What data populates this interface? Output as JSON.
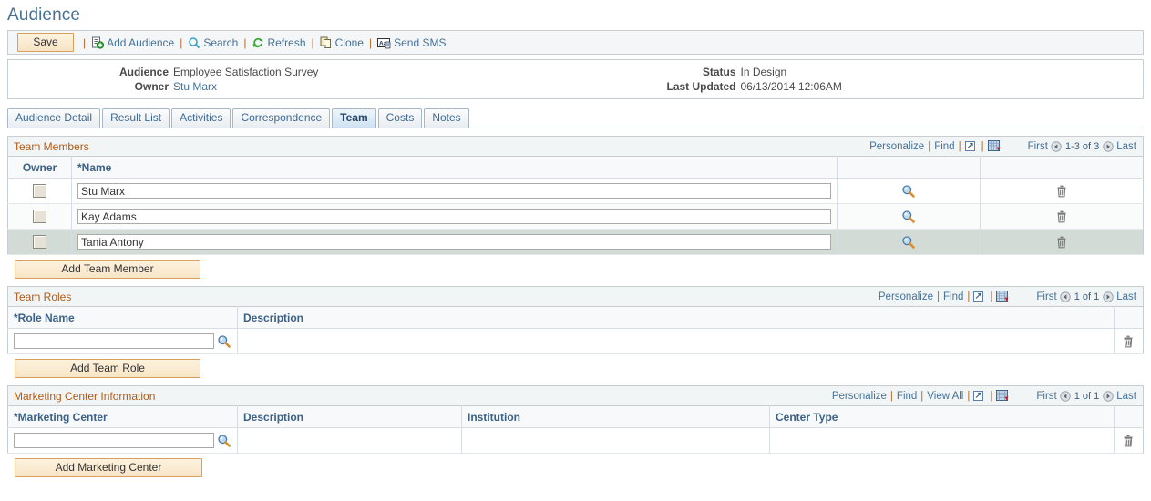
{
  "page": {
    "title": "Audience"
  },
  "toolbar": {
    "save_label": "Save",
    "items": [
      {
        "label": "Add Audience",
        "icon": "add-audience-icon"
      },
      {
        "label": "Search",
        "icon": "search-icon"
      },
      {
        "label": "Refresh",
        "icon": "refresh-icon"
      },
      {
        "label": "Clone",
        "icon": "clone-icon"
      },
      {
        "label": "Send SMS",
        "icon": "send-sms-icon"
      }
    ],
    "separator": "|"
  },
  "summary": {
    "audience_label": "Audience",
    "audience_value": "Employee Satisfaction Survey",
    "owner_label": "Owner",
    "owner_value": "Stu Marx",
    "status_label": "Status",
    "status_value": "In Design",
    "last_updated_label": "Last Updated",
    "last_updated_value": "06/13/2014 12:06AM"
  },
  "tabs": [
    {
      "label": "Audience Detail",
      "accesskey": "D",
      "active": false
    },
    {
      "label": "Result List",
      "accesskey": "R",
      "active": false
    },
    {
      "label": "Activities",
      "accesskey": "A",
      "active": false
    },
    {
      "label": "Correspondence",
      "accesskey": "p",
      "active": false
    },
    {
      "label": "Team",
      "accesskey": "",
      "active": true
    },
    {
      "label": "Costs",
      "accesskey": "C",
      "active": false
    },
    {
      "label": "Notes",
      "accesskey": "N",
      "active": false
    }
  ],
  "team_members": {
    "title": "Team Members",
    "tools": {
      "personalize": "Personalize",
      "find": "Find",
      "sep": "|",
      "expand_icon": "expand-grid-icon",
      "download_icon": "download-spreadsheet-icon"
    },
    "nav": {
      "first": "First",
      "prev_icon": "previous-page-icon",
      "range": "1-3 of 3",
      "next_icon": "next-page-icon",
      "last": "Last"
    },
    "columns": [
      "Owner",
      "*Name",
      "",
      ""
    ],
    "rows": [
      {
        "owner_checked": false,
        "name": "Stu Marx"
      },
      {
        "owner_checked": false,
        "name": "Kay Adams"
      },
      {
        "owner_checked": false,
        "name": "Tania Antony"
      }
    ],
    "add_button": "Add Team Member"
  },
  "team_roles": {
    "title": "Team Roles",
    "tools": {
      "personalize": "Personalize",
      "find": "Find",
      "sep": "|",
      "expand_icon": "expand-grid-icon",
      "download_icon": "download-spreadsheet-icon"
    },
    "nav": {
      "first": "First",
      "prev_icon": "previous-page-icon",
      "range": "1 of 1",
      "next_icon": "next-page-icon",
      "last": "Last"
    },
    "columns": [
      "*Role Name",
      "Description",
      ""
    ],
    "rows": [
      {
        "role_name": "",
        "role_name_placeholder": "",
        "description": ""
      }
    ],
    "add_button": "Add Team Role"
  },
  "marketing_center": {
    "title": "Marketing Center Information",
    "tools": {
      "personalize": "Personalize",
      "find": "Find",
      "view_all": "View All",
      "sep": "|",
      "expand_icon": "expand-grid-icon",
      "download_icon": "download-spreadsheet-icon"
    },
    "nav": {
      "first": "First",
      "prev_icon": "previous-page-icon",
      "range": "1 of 1",
      "next_icon": "next-page-icon",
      "last": "Last"
    },
    "columns": [
      "*Marketing Center",
      "Description",
      "Institution",
      "Center Type",
      ""
    ],
    "rows": [
      {
        "marketing_center": "",
        "description": "",
        "institution": "",
        "center_type": ""
      }
    ],
    "add_button": "Add Marketing Center"
  },
  "colors": {
    "title": "#46729a",
    "section_title": "#b05a17",
    "link": "#46729a",
    "separator": "#b06a2c",
    "button_border": "#d9a05b",
    "selected_row": "#d3dbd7",
    "active_tab": "#cfe2f2"
  }
}
